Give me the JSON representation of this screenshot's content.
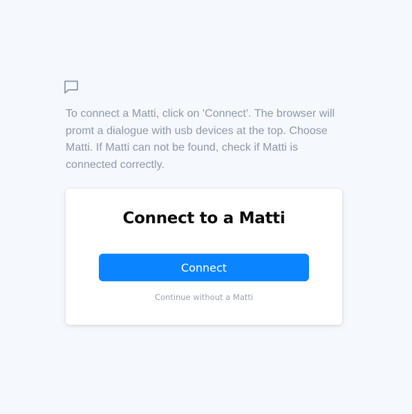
{
  "info": {
    "icon": "chat-bubble-icon",
    "text": "To connect a Matti, click on 'Connect'. The browser will promt a dialogue with usb devices at the top. Choose Matti. If Matti can not be found, check if Matti is connected correctly."
  },
  "card": {
    "title": "Connect to a Matti",
    "connect_label": "Connect",
    "continue_label": "Continue without a Matti"
  },
  "colors": {
    "background": "#f5f8fc",
    "accent": "#0a84ff",
    "muted_text": "#8e98a8",
    "card": "#ffffff"
  }
}
